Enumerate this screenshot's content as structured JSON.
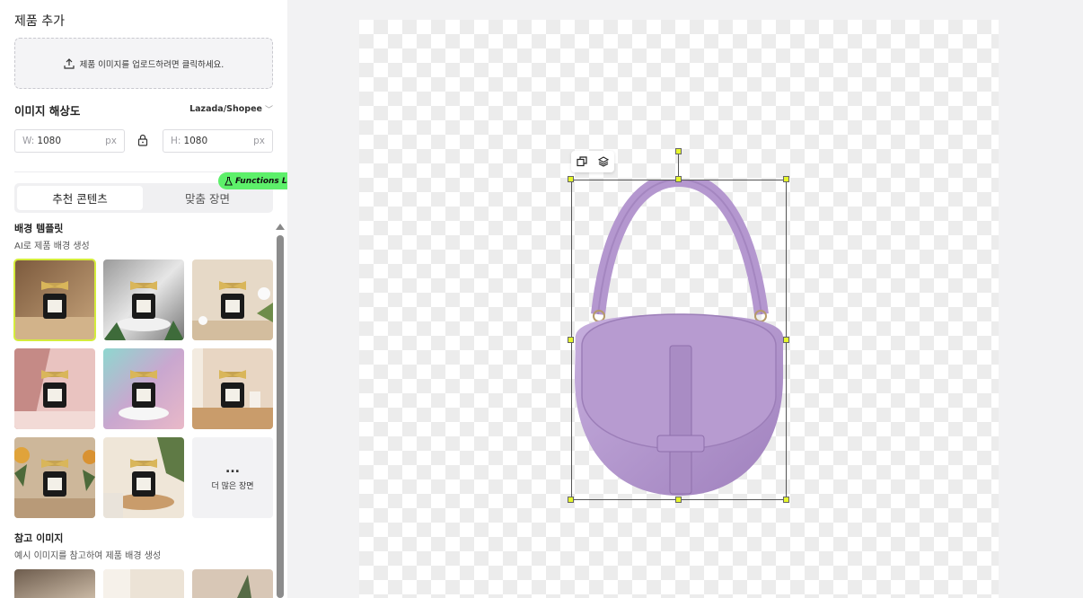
{
  "sidebar": {
    "add_product_title": "제품 추가",
    "upload_text": "제품 이미지를 업로드하려면 클릭하세요.",
    "resolution": {
      "title": "이미지 해상도",
      "preset": "Lazada/Shopee",
      "width_prefix": "W:",
      "width_value": "1080",
      "height_prefix": "H:",
      "height_value": "1080",
      "unit": "px"
    },
    "tabs": [
      {
        "label": "추천 콘텐츠",
        "active": true
      },
      {
        "label": "맞춤 장면",
        "active": false
      }
    ],
    "badge": "Functions Lab",
    "background_templates": {
      "title": "배경 템플릿",
      "subtitle": "AI로 제품 배경 생성",
      "more_label": "더 많은 장면"
    },
    "reference_images": {
      "title": "참고 이미지",
      "subtitle": "예시 이미지를 참고하여 제품 배경 생성"
    }
  },
  "colors": {
    "accent_badge": "#5df06a",
    "selection_handle": "#e5f52c",
    "bag": "#b79bd0"
  },
  "canvas": {
    "toolbar_icons": [
      "duplicate-icon",
      "layers-icon"
    ]
  }
}
